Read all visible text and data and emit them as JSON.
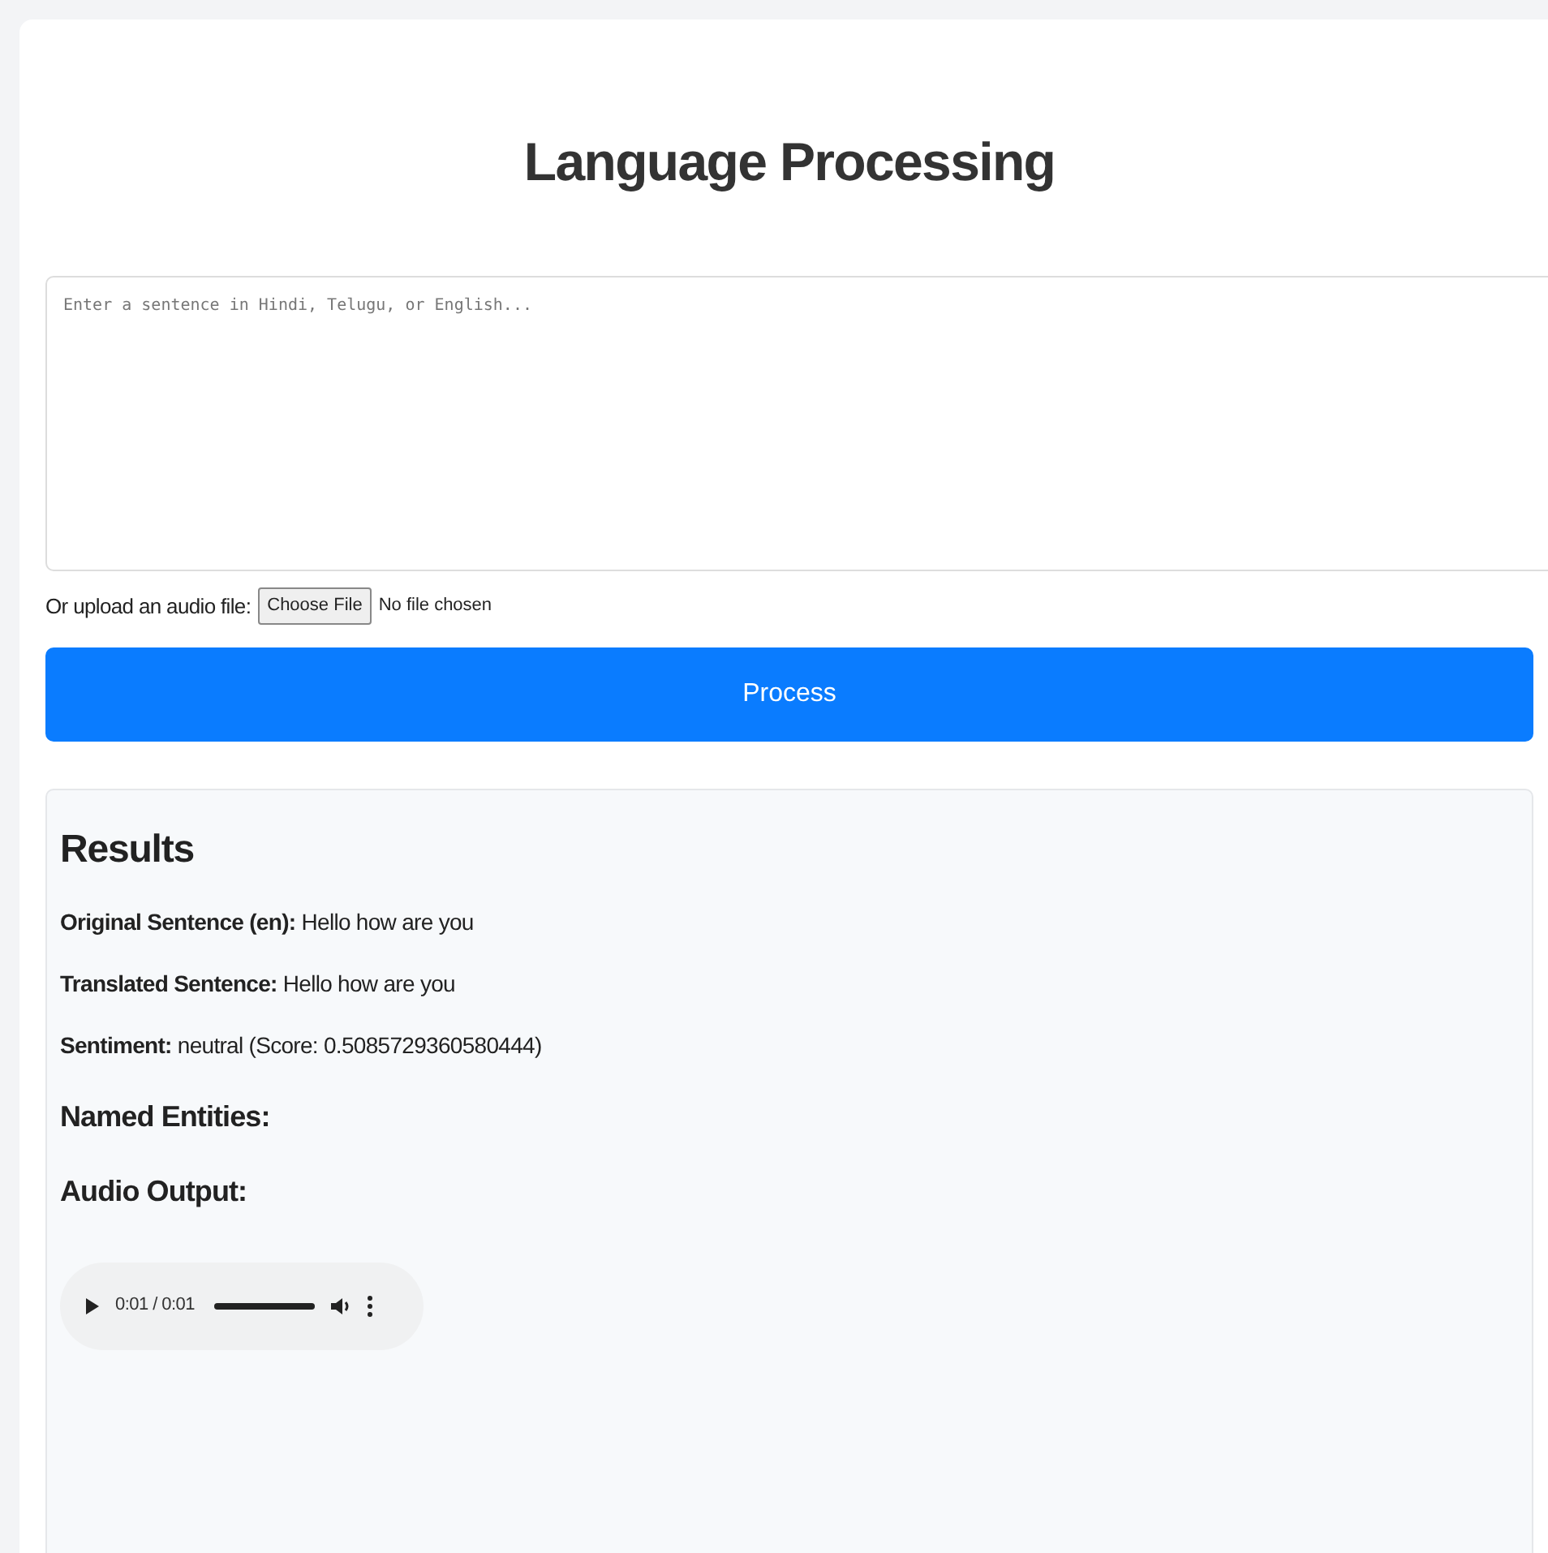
{
  "title": "Language Processing",
  "input": {
    "placeholder": "Enter a sentence in Hindi, Telugu, or English..."
  },
  "upload": {
    "label": "Or upload an audio file:",
    "button": "Choose File",
    "status": "No file chosen"
  },
  "process_button": "Process",
  "results": {
    "heading": "Results",
    "lines": [
      "**Original Sentence (en):** Hello how are you",
      "**Translated Sentence:** Hello how are you",
      "**Sentiment:** neutral (Score: 0.5085729360580444)"
    ],
    "subheadings": [
      "Named Entities:",
      "Audio Output:"
    ],
    "audio": {
      "time": "0:01 / 0:01",
      "level": 1
    }
  }
}
